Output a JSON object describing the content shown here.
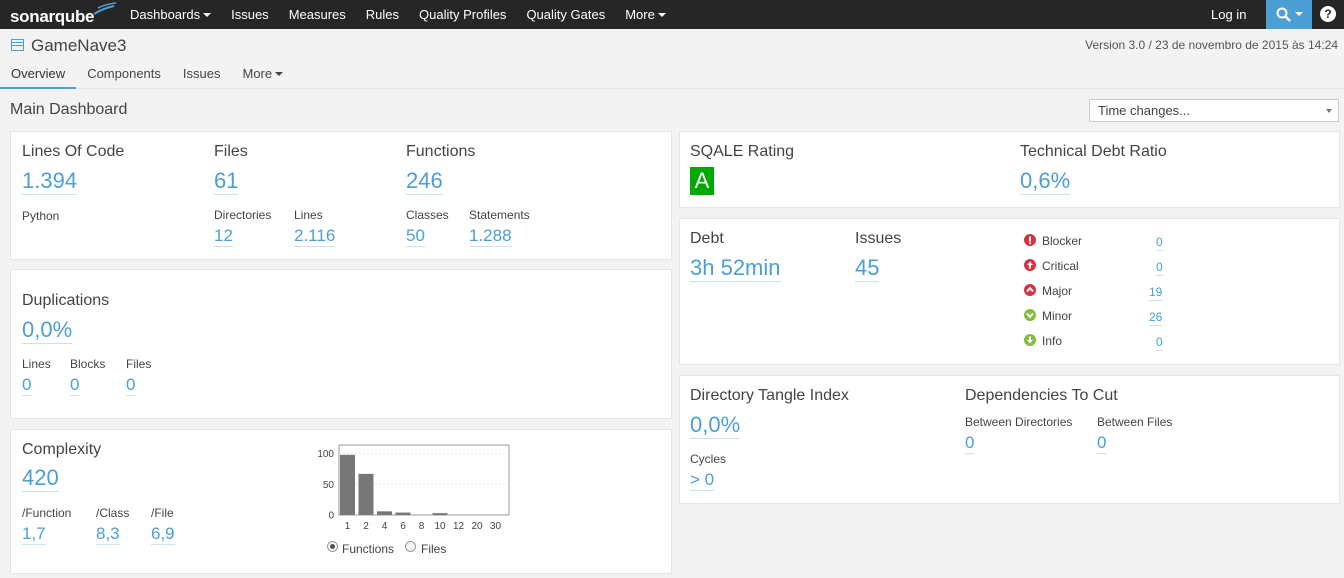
{
  "app": {
    "logo_text": "sonarqube"
  },
  "topnav": {
    "items": [
      "Dashboards",
      "Issues",
      "Measures",
      "Rules",
      "Quality Profiles",
      "Quality Gates",
      "More"
    ],
    "login": "Log in",
    "help": "?"
  },
  "project": {
    "name": "GameNave3",
    "version": "Version 3.0 / 23 de novembro de 2015 às 14:24",
    "tabs": [
      "Overview",
      "Components",
      "Issues",
      "More"
    ]
  },
  "dashboard": {
    "title": "Main Dashboard",
    "time_select": "Time changes..."
  },
  "size": {
    "loc_label": "Lines Of Code",
    "loc_value": "1.394",
    "language": "Python",
    "files_label": "Files",
    "files_value": "61",
    "functions_label": "Functions",
    "functions_value": "246",
    "directories_label": "Directories",
    "directories_value": "12",
    "lines_label": "Lines",
    "lines_value": "2.116",
    "classes_label": "Classes",
    "classes_value": "50",
    "statements_label": "Statements",
    "statements_value": "1.288"
  },
  "duplications": {
    "label": "Duplications",
    "value": "0,0%",
    "lines_label": "Lines",
    "lines_value": "0",
    "blocks_label": "Blocks",
    "blocks_value": "0",
    "files_label": "Files",
    "files_value": "0"
  },
  "complexity": {
    "label": "Complexity",
    "value": "420",
    "per_function_label": "/Function",
    "per_function_value": "1,7",
    "per_class_label": "/Class",
    "per_class_value": "8,3",
    "per_file_label": "/File",
    "per_file_value": "6,9",
    "radio_functions": "Functions",
    "radio_files": "Files"
  },
  "chart_data": {
    "type": "bar",
    "categories": [
      "1",
      "2",
      "4",
      "6",
      "8",
      "10",
      "12",
      "20",
      "30"
    ],
    "values": [
      98,
      67,
      6,
      4,
      0,
      3,
      0,
      0,
      0
    ],
    "yticks": [
      "0",
      "50",
      "100"
    ],
    "ylim": [
      0,
      114
    ],
    "title": "",
    "xlabel": "",
    "ylabel": "",
    "bar_color": "#777777"
  },
  "sqale": {
    "rating_label": "SQALE Rating",
    "rating_value": "A",
    "rating_color": "#00aa00",
    "tdr_label": "Technical Debt Ratio",
    "tdr_value": "0,6%"
  },
  "issues": {
    "debt_label": "Debt",
    "debt_value": "3h 52min",
    "issues_label": "Issues",
    "issues_value": "45",
    "severities": [
      {
        "name": "Blocker",
        "count": "0"
      },
      {
        "name": "Critical",
        "count": "0"
      },
      {
        "name": "Major",
        "count": "19"
      },
      {
        "name": "Minor",
        "count": "26"
      },
      {
        "name": "Info",
        "count": "0"
      }
    ]
  },
  "design": {
    "dti_label": "Directory Tangle Index",
    "dti_value": "0,0%",
    "cycles_label": "Cycles",
    "cycles_value": "> 0",
    "deps_label": "Dependencies To Cut",
    "between_dirs_label": "Between Directories",
    "between_dirs_value": "0",
    "between_files_label": "Between Files",
    "between_files_value": "0"
  }
}
